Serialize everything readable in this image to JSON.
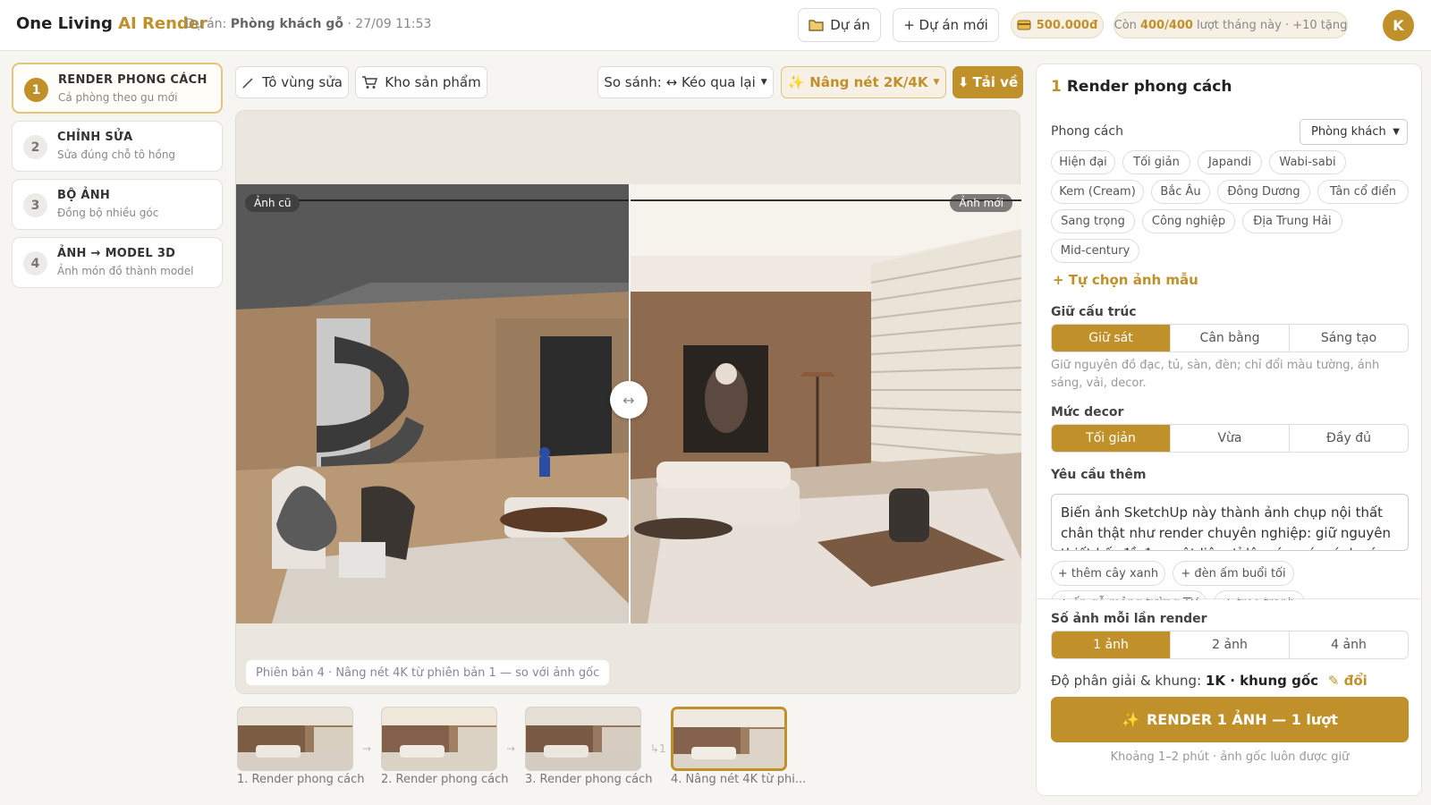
{
  "header": {
    "brand_main": "One Living",
    "brand_accent": "AI Render",
    "project_prefix": "Dự án:",
    "project_name": "Phòng khách gỗ",
    "project_time": "· 27/09 11:53",
    "btn_projects": "Dự án",
    "btn_new_project": "+ Dự án mới",
    "balance": "500.000đ",
    "quota_prefix": "Còn",
    "quota_value": "400/400",
    "quota_suffix": "lượt tháng này · +10 tặng",
    "avatar_initial": "K"
  },
  "steps": [
    {
      "num": "1",
      "title": "RENDER PHONG CÁCH",
      "subtitle": "Cả phòng theo gu mới"
    },
    {
      "num": "2",
      "title": "CHỈNH SỬA",
      "subtitle": "Sửa đúng chỗ tô hồng"
    },
    {
      "num": "3",
      "title": "BỘ ẢNH",
      "subtitle": "Đồng bộ nhiều góc"
    },
    {
      "num": "4",
      "title": "ẢNH → MODEL 3D",
      "subtitle": "Ảnh món đồ thành model"
    }
  ],
  "canvas_toolbar": {
    "paint_area": "Tô vùng sửa",
    "product_store": "Kho sản phẩm",
    "compare": "So sánh: ↔ Kéo qua lại",
    "upscale": "Nâng nét 2K/4K",
    "download": "Tải về"
  },
  "viewer": {
    "label_old": "Ảnh cũ",
    "label_new": "Ảnh mới",
    "handle": "↔",
    "caption": "Phiên bản 4 · Nâng nét 4K từ phiên bản 1 — so với ảnh gốc"
  },
  "versions": [
    {
      "label": "1. Render phong cách"
    },
    {
      "label": "2. Render phong cách"
    },
    {
      "label": "3. Render phong cách"
    },
    {
      "label": "4. Nâng nét 4K từ phi..."
    }
  ],
  "version_link_marker": "↳1",
  "panel": {
    "step_num": "1",
    "title": "Render phong cách",
    "style_label": "Phong cách",
    "room_select": "Phòng khách",
    "styles": [
      "Hiện đại",
      "Tối giản",
      "Japandi",
      "Wabi-sabi",
      "Kem (Cream)",
      "Bắc Âu",
      "Đông Dương",
      "Tân cổ điển",
      "Sang trọng",
      "Công nghiệp",
      "Địa Trung Hải",
      "Mid-century"
    ],
    "custom_sample": "+ Tự chọn ảnh mẫu",
    "structure_label": "Giữ cấu trúc",
    "structure_options": [
      "Giữ sát",
      "Cân bằng",
      "Sáng tạo"
    ],
    "structure_selected": "Giữ sát",
    "structure_hint": "Giữ nguyên đồ đạc, tủ, sàn, đèn; chỉ đổi màu tường, ánh sáng, vải, decor.",
    "decor_label": "Mức decor",
    "decor_options": [
      "Tối giản",
      "Vừa",
      "Đầy đủ"
    ],
    "decor_selected": "Tối giản",
    "extra_label": "Yêu cầu thêm",
    "extra_text": "Biến ảnh SketchUp này thành ảnh chụp nội thất chân thật như render chuyên nghiệp: giữ nguyên thiết kế, đồ đạc, vật liệu, tỉ lệ, góc máy, ánh sáng",
    "suggestions": [
      "+ thêm cây xanh",
      "+ đèn ấm buổi tối",
      "+ ốp gỗ mảng tường TV",
      "+ treo tranh"
    ],
    "count_label": "Số ảnh mỗi lần render",
    "count_options": [
      "1 ảnh",
      "2 ảnh",
      "4 ảnh"
    ],
    "count_selected": "1 ảnh",
    "resolution_label": "Độ phân giải & khung:",
    "resolution_value": "1K · khung gốc",
    "resolution_change": "✎ đổi",
    "render_button": "RENDER 1 ẢNH — 1 lượt",
    "footnote": "Khoảng 1–2 phút · ảnh gốc luôn được giữ"
  },
  "colors": {
    "accent": "#c0902a",
    "accent_light": "#f6f1e4"
  }
}
